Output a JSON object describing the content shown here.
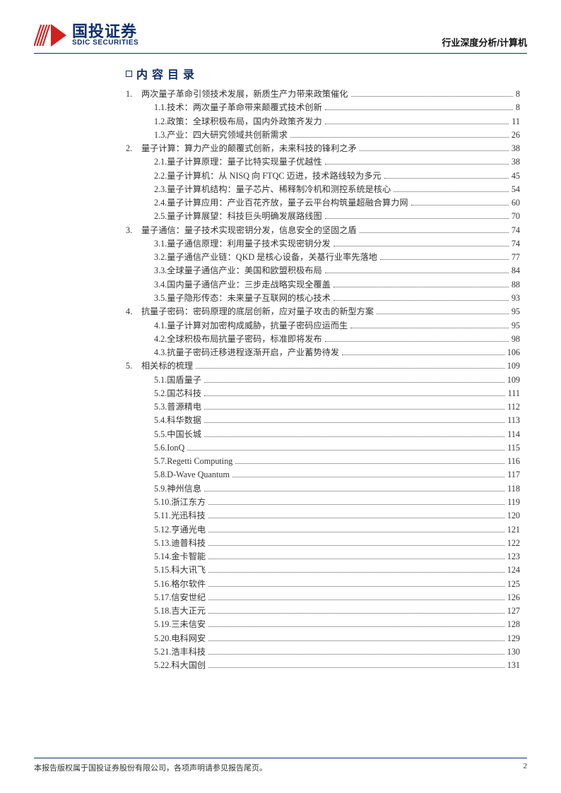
{
  "header": {
    "logo_cn": "国投证券",
    "logo_en": "SDIC SECURITIES",
    "doc_type": "行业深度分析/计算机"
  },
  "toc_title": "内容目录",
  "toc": [
    {
      "level": 1,
      "num": "1.",
      "text": "两次量子革命引领技术发展，新质生产力带来政策催化",
      "page": "8"
    },
    {
      "level": 2,
      "num": "1.1.",
      "text": "技术：两次量子革命带来颠覆式技术创新",
      "page": "8"
    },
    {
      "level": 2,
      "num": "1.2.",
      "text": "政策：全球积极布局，国内外政策齐发力",
      "page": "11"
    },
    {
      "level": 2,
      "num": "1.3.",
      "text": "产业：四大研究领域共创新需求",
      "page": "26"
    },
    {
      "level": 1,
      "num": "2.",
      "text": "量子计算：算力产业的颠覆式创新，未来科技的锋利之矛",
      "page": "38"
    },
    {
      "level": 2,
      "num": "2.1.",
      "text": "量子计算原理：量子比特实现量子优越性",
      "page": "38"
    },
    {
      "level": 2,
      "num": "2.2.",
      "text": "量子计算机：从 NISQ 向 FTQC 迈进，技术路线较为多元",
      "page": "45"
    },
    {
      "level": 2,
      "num": "2.3.",
      "text": "量子计算机结构：量子芯片、稀释制冷机和测控系统是核心",
      "page": "54"
    },
    {
      "level": 2,
      "num": "2.4.",
      "text": "量子计算应用：产业百花齐放，量子云平台构筑量超融合算力网",
      "page": "60"
    },
    {
      "level": 2,
      "num": "2.5.",
      "text": "量子计算展望：科技巨头明确发展路线图",
      "page": "70"
    },
    {
      "level": 1,
      "num": "3.",
      "text": "量子通信：量子技术实现密钥分发，信息安全的坚固之盾",
      "page": "74"
    },
    {
      "level": 2,
      "num": "3.1.",
      "text": "量子通信原理：利用量子技术实现密钥分发",
      "page": "74"
    },
    {
      "level": 2,
      "num": "3.2.",
      "text": "量子通信产业链：QKD 是核心设备，关基行业率先落地",
      "page": "77"
    },
    {
      "level": 2,
      "num": "3.3.",
      "text": "全球量子通信产业：美国和欧盟积极布局",
      "page": "84"
    },
    {
      "level": 2,
      "num": "3.4.",
      "text": "国内量子通信产业：三步走战略实现全覆盖",
      "page": "88"
    },
    {
      "level": 2,
      "num": "3.5.",
      "text": "量子隐形传态：未来量子互联网的核心技术",
      "page": "93"
    },
    {
      "level": 1,
      "num": "4.",
      "text": "抗量子密码：密码原理的底层创新，应对量子攻击的新型方案",
      "page": "95"
    },
    {
      "level": 2,
      "num": "4.1.",
      "text": "量子计算对加密构成威胁，抗量子密码应运而生",
      "page": "95"
    },
    {
      "level": 2,
      "num": "4.2.",
      "text": "全球积极布局抗量子密码，标准即将发布",
      "page": "98"
    },
    {
      "level": 2,
      "num": "4.3.",
      "text": "抗量子密码迁移进程逐渐开启，产业蓄势待发",
      "page": "106"
    },
    {
      "level": 1,
      "num": "5.",
      "text": "相关标的梳理",
      "page": "109"
    },
    {
      "level": 2,
      "num": "5.1.",
      "text": "国盾量子",
      "page": "109"
    },
    {
      "level": 2,
      "num": "5.2.",
      "text": "国芯科技",
      "page": "111"
    },
    {
      "level": 2,
      "num": "5.3.",
      "text": "普源精电",
      "page": "112"
    },
    {
      "level": 2,
      "num": "5.4.",
      "text": "科华数据",
      "page": "113"
    },
    {
      "level": 2,
      "num": "5.5.",
      "text": "中国长城",
      "page": "114"
    },
    {
      "level": 2,
      "num": "5.6.",
      "text": "IonQ",
      "page": "115"
    },
    {
      "level": 2,
      "num": "5.7.",
      "text": "Regetti Computing",
      "page": "116"
    },
    {
      "level": 2,
      "num": "5.8.",
      "text": "D-Wave Quantum",
      "page": "117"
    },
    {
      "level": 2,
      "num": "5.9.",
      "text": "神州信息",
      "page": "118"
    },
    {
      "level": 2,
      "num": "5.10.",
      "text": "浙江东方",
      "page": "119"
    },
    {
      "level": 2,
      "num": "5.11.",
      "text": "光迅科技",
      "page": "120"
    },
    {
      "level": 2,
      "num": "5.12.",
      "text": "亨通光电",
      "page": "121"
    },
    {
      "level": 2,
      "num": "5.13.",
      "text": "迪普科技",
      "page": "122"
    },
    {
      "level": 2,
      "num": "5.14.",
      "text": "金卡智能",
      "page": "123"
    },
    {
      "level": 2,
      "num": "5.15.",
      "text": "科大讯飞",
      "page": "124"
    },
    {
      "level": 2,
      "num": "5.16.",
      "text": "格尔软件",
      "page": "125"
    },
    {
      "level": 2,
      "num": "5.17.",
      "text": "信安世纪",
      "page": "126"
    },
    {
      "level": 2,
      "num": "5.18.",
      "text": "吉大正元",
      "page": "127"
    },
    {
      "level": 2,
      "num": "5.19.",
      "text": "三未信安",
      "page": "128"
    },
    {
      "level": 2,
      "num": "5.20.",
      "text": "电科网安",
      "page": "129"
    },
    {
      "level": 2,
      "num": "5.21.",
      "text": "浩丰科技",
      "page": "130"
    },
    {
      "level": 2,
      "num": "5.22.",
      "text": "科大国创",
      "page": "131"
    }
  ],
  "footer": {
    "copyright": "本报告版权属于国投证券股份有限公司，各项声明请参见报告尾页。",
    "page_num": "2"
  }
}
